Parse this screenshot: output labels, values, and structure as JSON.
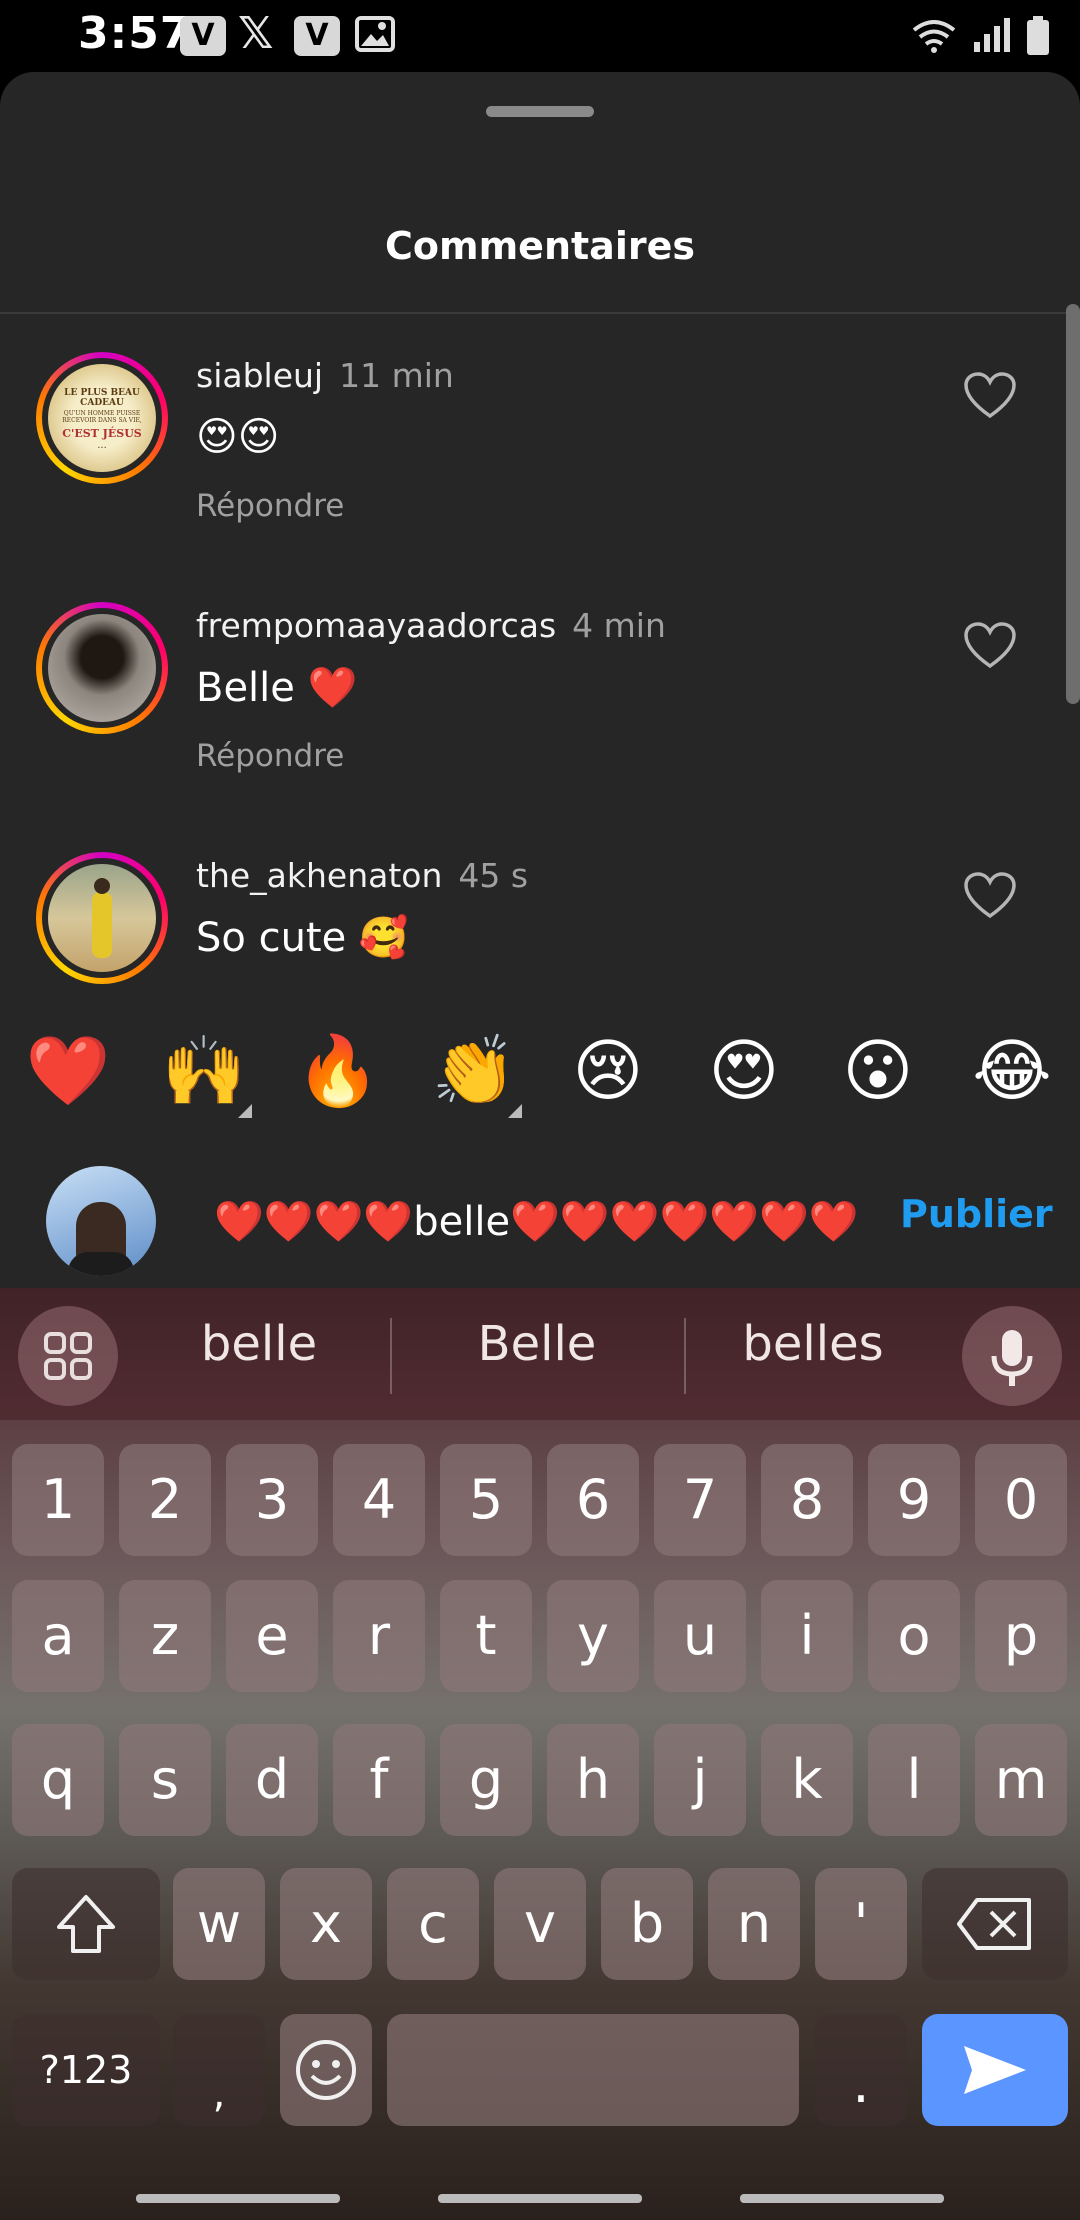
{
  "status_bar": {
    "time": "3:57",
    "icons": [
      "v-app-icon",
      "x-app-icon",
      "v-app-icon",
      "image-icon",
      "wifi-icon",
      "signal-icon",
      "battery-icon"
    ]
  },
  "sheet": {
    "title": "Commentaires",
    "comments": [
      {
        "username": "siableuj",
        "time": "11 min",
        "text": "😍😍",
        "reply": "Répondre"
      },
      {
        "username": "frempomaayaadorcas",
        "time": "4 min",
        "text": "Belle ❤️",
        "reply": "Répondre"
      },
      {
        "username": "the_akhenaton",
        "time": "45 s",
        "text": "So cute 🥰"
      }
    ],
    "avatar1_text": {
      "line1": "LE PLUS BEAU CADEAU",
      "line2": "QU'UN HOMME PUISSE RECEVOIR DANS SA VIE,",
      "line3": "C'EST JÉSUS",
      "line4": "..."
    }
  },
  "emoji_bar": [
    "❤️",
    "🙌",
    "🔥",
    "👏",
    "😢",
    "😍",
    "😮",
    "😂"
  ],
  "composer": {
    "input_value": "❤️❤️❤️❤️belle❤️❤️❤️❤️❤️❤️❤️❤️",
    "publish_label": "Publier"
  },
  "keyboard": {
    "suggestions": [
      "belle",
      "Belle",
      "belles"
    ],
    "row_numbers": [
      "1",
      "2",
      "3",
      "4",
      "5",
      "6",
      "7",
      "8",
      "9",
      "0"
    ],
    "row1": [
      "a",
      "z",
      "e",
      "r",
      "t",
      "y",
      "u",
      "i",
      "o",
      "p"
    ],
    "row2": [
      "q",
      "s",
      "d",
      "f",
      "g",
      "h",
      "j",
      "k",
      "l",
      "m"
    ],
    "row3": [
      "w",
      "x",
      "c",
      "v",
      "b",
      "n",
      "'"
    ],
    "symbols_label": "?123",
    "comma": ",",
    "period": "."
  },
  "colors": {
    "accent": "#1f9bf0",
    "sheet_bg": "#262626",
    "send_key": "#5b95ff"
  }
}
